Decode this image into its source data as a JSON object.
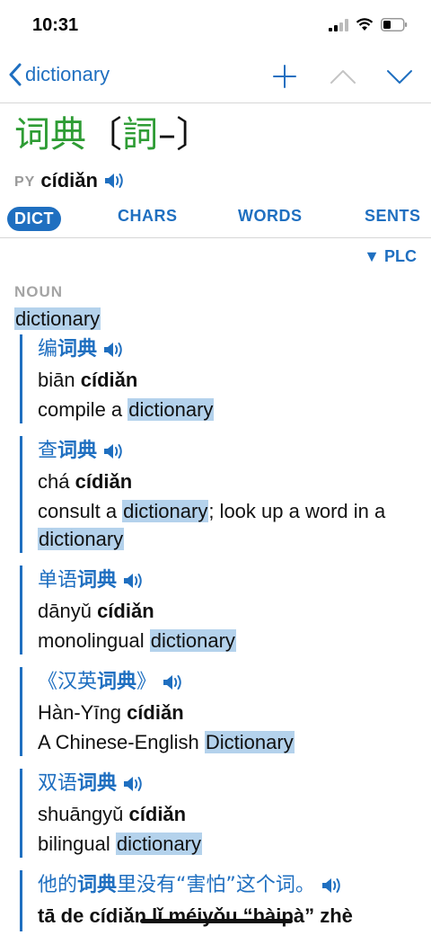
{
  "status": {
    "time": "10:31"
  },
  "nav": {
    "back_label": "dictionary"
  },
  "entry": {
    "simplified": "词典",
    "open_bracket": "〔",
    "traditional": "詞",
    "dash": "–",
    "close_bracket": "〕",
    "py_label": "PY",
    "pinyin": "cídiǎn"
  },
  "tabs": [
    "DICT",
    "CHARS",
    "WORDS",
    "SENTS"
  ],
  "plc_label": "▼ PLC",
  "sense": {
    "pos": "NOUN",
    "gloss": "dictionary",
    "examples": [
      {
        "zh_pre": "编",
        "zh_bold": "词典",
        "zh_post": "",
        "py_pre": "biān ",
        "py_bold": "cídiǎn",
        "en_pre": "compile a ",
        "en_hl": "dictionary",
        "en_post": ""
      },
      {
        "zh_pre": "查",
        "zh_bold": "词典",
        "zh_post": "",
        "py_pre": "chá ",
        "py_bold": "cídiǎn",
        "en_pre": "consult a ",
        "en_hl": "dictionary",
        "en_mid": "; look up a word in a ",
        "en_hl2": "dictionary"
      },
      {
        "zh_pre": "单语",
        "zh_bold": "词典",
        "zh_post": "",
        "py_pre": "dānyǔ ",
        "py_bold": "cídiǎn",
        "en_pre": "monolingual ",
        "en_hl": "dictionary",
        "en_post": ""
      },
      {
        "zh_pre": "《汉英",
        "zh_bold": "词典",
        "zh_post": "》",
        "py_pre": "Hàn-Yīng ",
        "py_bold": "cídiǎn",
        "en_pre": "A Chinese-English ",
        "en_hl": "Dictionary",
        "en_post": ""
      },
      {
        "zh_pre": "双语",
        "zh_bold": "词典",
        "zh_post": "",
        "py_pre": "shuāngyǔ ",
        "py_bold": "cídiǎn",
        "en_pre": "bilingual ",
        "en_hl": "dictionary",
        "en_post": ""
      },
      {
        "zh_pre": "他的",
        "zh_bold": "词典",
        "zh_post": "里没有“害怕”这个词。",
        "py_pre": "tā de cídiǎn lǐ méiyǒu “hàipà” zhè"
      }
    ]
  }
}
